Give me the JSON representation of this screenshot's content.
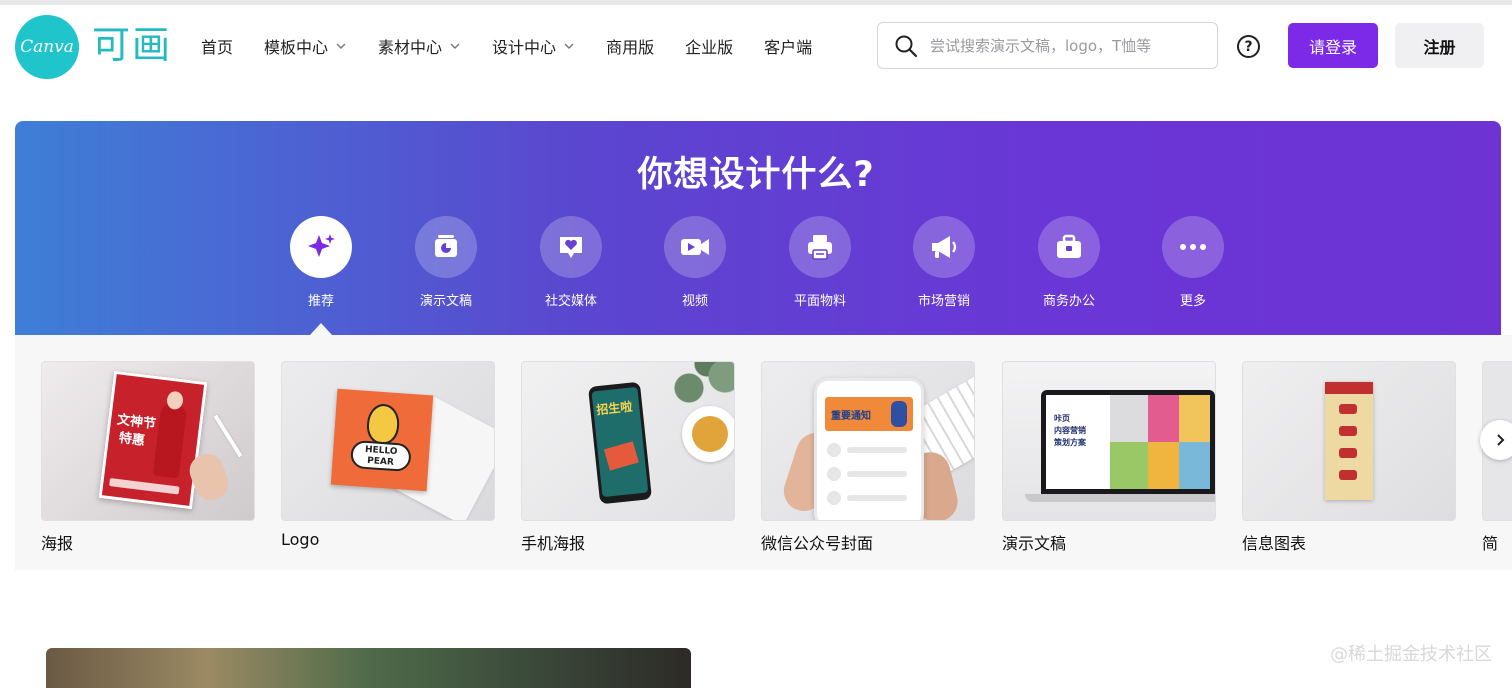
{
  "header": {
    "logo_text": "Canva",
    "logo_cn": "可画",
    "nav": [
      {
        "label": "首页",
        "has_dropdown": false
      },
      {
        "label": "模板中心",
        "has_dropdown": true
      },
      {
        "label": "素材中心",
        "has_dropdown": true
      },
      {
        "label": "设计中心",
        "has_dropdown": true
      },
      {
        "label": "商用版",
        "has_dropdown": false
      },
      {
        "label": "企业版",
        "has_dropdown": false
      },
      {
        "label": "客户端",
        "has_dropdown": false
      }
    ],
    "search_placeholder": "尝试搜索演示文稿，logo，T恤等",
    "help_symbol": "?",
    "login_label": "请登录",
    "register_label": "注册"
  },
  "hero": {
    "title": "你想设计什么?",
    "categories": [
      {
        "label": "推荐",
        "icon": "sparkle-icon",
        "active": true
      },
      {
        "label": "演示文稿",
        "icon": "presentation-icon",
        "active": false
      },
      {
        "label": "社交媒体",
        "icon": "heart-chat-icon",
        "active": false
      },
      {
        "label": "视频",
        "icon": "video-camera-icon",
        "active": false
      },
      {
        "label": "平面物料",
        "icon": "printer-icon",
        "active": false
      },
      {
        "label": "市场营销",
        "icon": "megaphone-icon",
        "active": false
      },
      {
        "label": "商务办公",
        "icon": "briefcase-icon",
        "active": false
      },
      {
        "label": "更多",
        "icon": "more-dots-icon",
        "active": false
      }
    ]
  },
  "cards": [
    {
      "label": "海报",
      "thumb_lines": [
        "文神节",
        "特惠"
      ]
    },
    {
      "label": "Logo",
      "thumb_lines": [
        "HELLO",
        "PEAR"
      ]
    },
    {
      "label": "手机海报",
      "thumb_lines": [
        "招生啦"
      ]
    },
    {
      "label": "微信公众号封面",
      "thumb_lines": [
        "重要通知"
      ]
    },
    {
      "label": "演示文稿",
      "thumb_lines": [
        "咔页",
        "内容营销",
        "策划方案"
      ]
    },
    {
      "label": "信息图表",
      "thumb_lines": []
    },
    {
      "label": "简",
      "thumb_lines": []
    }
  ],
  "watermark": "@稀土掘金技术社区",
  "colors": {
    "brand_purple": "#7d2ae8",
    "canva_teal": "#20c4cb",
    "hero_start": "#3e7fd6",
    "hero_end": "#6d33d3"
  }
}
